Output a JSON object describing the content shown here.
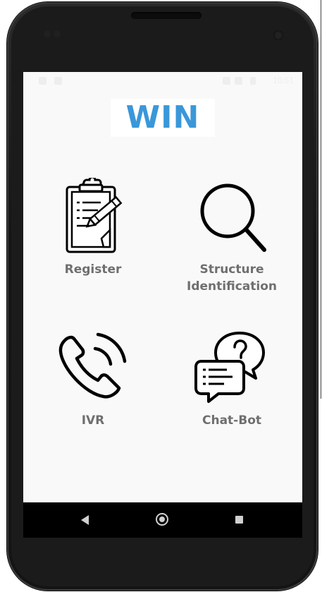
{
  "app": {
    "logo_text": "WIN",
    "logo_color": "#3a97d9"
  },
  "status_bar": {
    "time": "10:51"
  },
  "menu": {
    "items": [
      {
        "label": "Register",
        "icon": "clipboard-pencil-icon"
      },
      {
        "label": "Structure\nIdentification",
        "icon": "magnifier-icon"
      },
      {
        "label": "IVR",
        "icon": "phone-call-icon"
      },
      {
        "label": "Chat-Bot",
        "icon": "chat-question-icon"
      }
    ]
  },
  "navigation": {
    "back": "back-triangle-icon",
    "home": "home-circle-icon",
    "recent": "recent-square-icon"
  },
  "colors": {
    "label": "#6f6f6f",
    "screen_bg": "#f9f9f9",
    "nav_bg": "#000000"
  }
}
